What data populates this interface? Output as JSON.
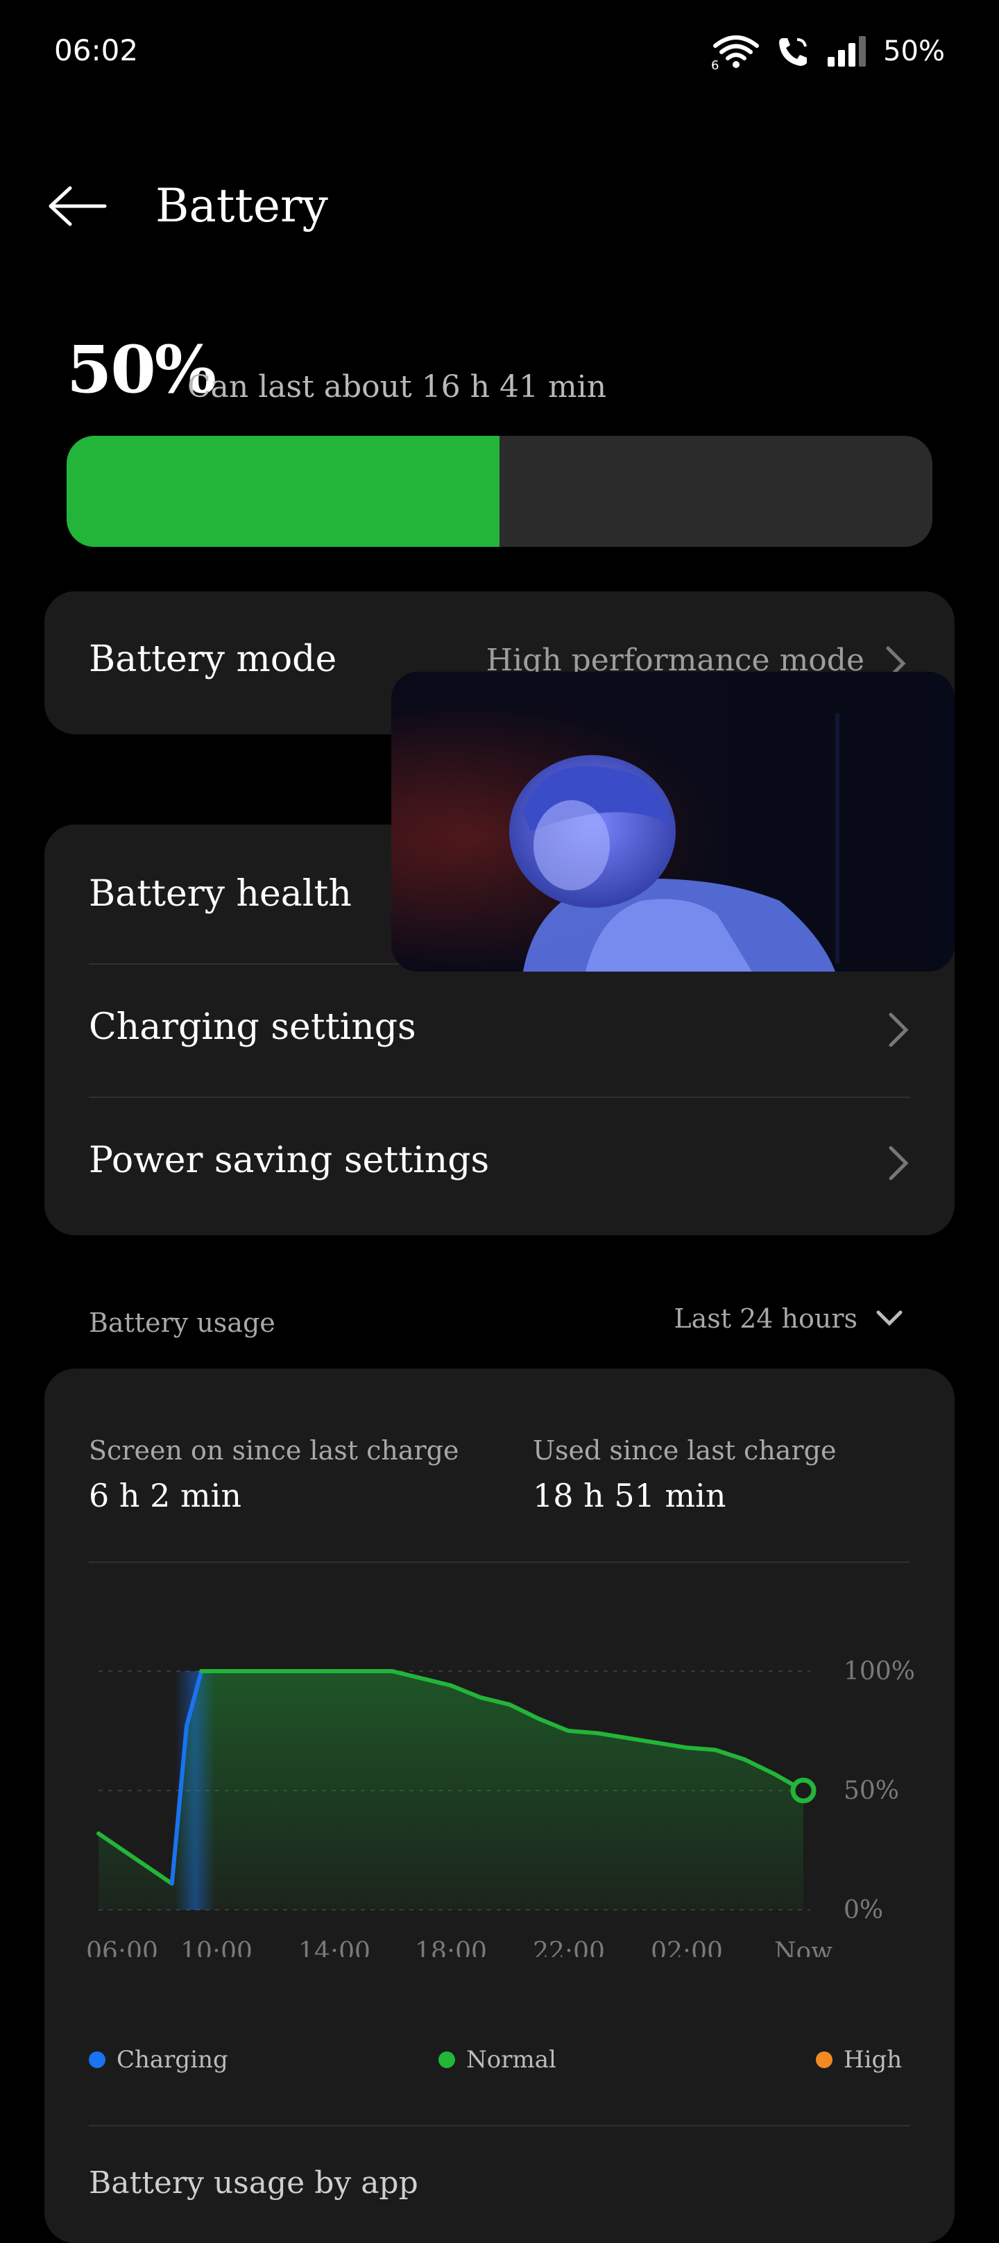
{
  "status_bar": {
    "time": "06:02",
    "battery_text": "50%",
    "icons": [
      "wifi-icon",
      "wifi-calling-icon",
      "signal-icon"
    ]
  },
  "header": {
    "title": "Battery",
    "back_icon": "back-arrow-icon"
  },
  "battery": {
    "percent_label": "50%",
    "level": 0.5,
    "estimate": "Can last about 16 h 41 min",
    "fill_color": "#23b43a"
  },
  "battery_mode": {
    "label": "Battery mode",
    "value": "High performance mode"
  },
  "settings": [
    {
      "label": "Battery health"
    },
    {
      "label": "Charging settings"
    },
    {
      "label": "Power saving settings"
    }
  ],
  "usage": {
    "section_label": "Battery usage",
    "range_selector": "Last 24 hours",
    "screen_on_label": "Screen on since last charge",
    "screen_on_value": "6 h 2 min",
    "used_label": "Used since last charge",
    "used_value": "18 h 51 min",
    "next_section": "Battery usage by app"
  },
  "legend": [
    {
      "label": "Charging",
      "color": "#1a73f0"
    },
    {
      "label": "Normal",
      "color": "#23b43a"
    },
    {
      "label": "High",
      "color": "#f08a24"
    }
  ],
  "chart_data": {
    "type": "area",
    "x_tick_labels": [
      "06:00",
      "10:00",
      "14:00",
      "18:00",
      "22:00",
      "02:00",
      "Now"
    ],
    "y_tick_labels": [
      "100%",
      "50%",
      "0%"
    ],
    "ylim": [
      0,
      100
    ],
    "hours_since_start": [
      0,
      2.5,
      3,
      3.5,
      10,
      11,
      12,
      13,
      14,
      15,
      16,
      17,
      18,
      19,
      20,
      21,
      22,
      23,
      24
    ],
    "values": [
      32,
      11,
      77,
      100,
      100,
      97,
      94,
      89,
      86,
      80,
      75,
      74,
      72,
      70,
      68,
      67,
      63,
      57,
      50
    ],
    "charging_range_hours": [
      2.5,
      3.5
    ],
    "series": [
      {
        "name": "Normal",
        "color": "#23b43a"
      }
    ]
  }
}
